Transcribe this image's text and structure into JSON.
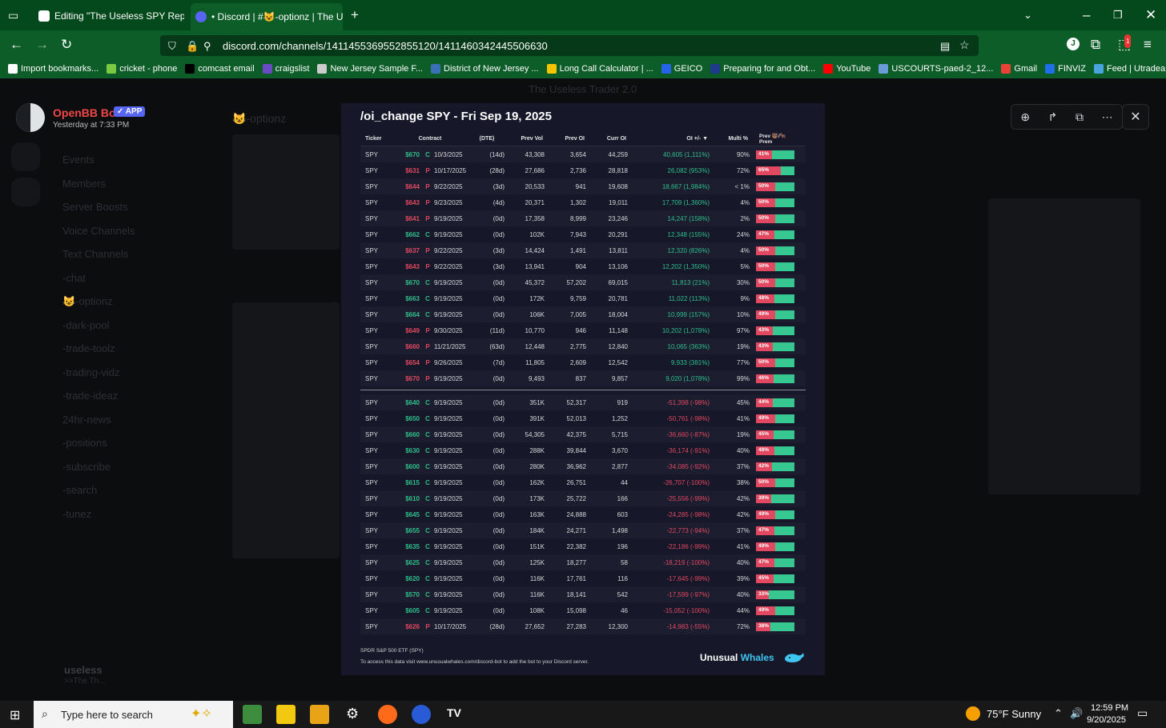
{
  "browser": {
    "tabs": [
      {
        "label": "Editing \"The Useless SPY Report",
        "active": false
      },
      {
        "label": "• Discord | #😺-optionz | The U",
        "active": true
      }
    ],
    "url": "discord.com/channels/1411455369552855120/1411460342445506630",
    "bookmarks": [
      "Import bookmarks...",
      "cricket - phone",
      "comcast email",
      "craigslist",
      "New Jersey Sample F...",
      "District of New Jersey ...",
      "Long Call Calculator | ...",
      "GEICO",
      "Preparing for and Obt...",
      "YouTube",
      "USCOURTS-paed-2_12...",
      "Gmail",
      "FINVIZ",
      "Feed | Utradea"
    ],
    "bookmark_icon_colors": [
      "#ffffff",
      "#7ac943",
      "#000000",
      "#6a4bc4",
      "#cccccc",
      "#3b6fb6",
      "#f5c400",
      "#2563eb",
      "#1e3a8a",
      "#ff0000",
      "#6a9bd8",
      "#ea4335",
      "#1f6feb",
      "#4aa3df"
    ],
    "extension_badge": "1",
    "profile_initial": "J"
  },
  "background": {
    "server_name": "The Useless Trader 2.0",
    "channel": "😺-optionz",
    "sidebar_items": [
      "Events",
      "Members",
      "Server Boosts",
      "Voice Channels",
      "Text Channels",
      "-chat",
      "😺-optionz",
      "-dark-pool",
      "-trade-toolz",
      "-trading-vidz",
      "-trade-ideaz",
      "24hr-news",
      "-positions",
      "-subscribe",
      "-search",
      "-tunez"
    ],
    "user_name": "useless",
    "user_status": ">>The Th..."
  },
  "message": {
    "bot_name": "OpenBB Bot",
    "badge": "✓ APP",
    "time": "Yesterday at 7:33 PM"
  },
  "report": {
    "title": "/oi_change SPY - Fri Sep 19, 2025",
    "headers": [
      "Ticker",
      "Contract",
      "(DTE)",
      "Prev Vol",
      "Prev OI",
      "Curr OI",
      "OI +/- ▼",
      "Multi %",
      "Prev 🐻/🐂 Prem"
    ],
    "gainers": [
      {
        "ticker": "SPY",
        "strike": "$670",
        "type": "C",
        "date": "10/3/2025",
        "dte": "(14d)",
        "prev_vol": "43,308",
        "prev_oi": "3,654",
        "curr_oi": "44,259",
        "oi_change": "40,605 (1,111%)",
        "multi": "90%",
        "prem": "41%",
        "prem_frac": 0.41
      },
      {
        "ticker": "SPY",
        "strike": "$631",
        "type": "P",
        "date": "10/17/2025",
        "dte": "(28d)",
        "prev_vol": "27,686",
        "prev_oi": "2,736",
        "curr_oi": "28,818",
        "oi_change": "26,082 (953%)",
        "multi": "72%",
        "prem": "65%",
        "prem_frac": 0.65
      },
      {
        "ticker": "SPY",
        "strike": "$644",
        "type": "P",
        "date": "9/22/2025",
        "dte": "(3d)",
        "prev_vol": "20,533",
        "prev_oi": "941",
        "curr_oi": "19,608",
        "oi_change": "18,667 (1,984%)",
        "multi": "< 1%",
        "prem": "50%",
        "prem_frac": 0.5
      },
      {
        "ticker": "SPY",
        "strike": "$643",
        "type": "P",
        "date": "9/23/2025",
        "dte": "(4d)",
        "prev_vol": "20,371",
        "prev_oi": "1,302",
        "curr_oi": "19,011",
        "oi_change": "17,709 (1,360%)",
        "multi": "4%",
        "prem": "50%",
        "prem_frac": 0.5
      },
      {
        "ticker": "SPY",
        "strike": "$641",
        "type": "P",
        "date": "9/19/2025",
        "dte": "(0d)",
        "prev_vol": "17,358",
        "prev_oi": "8,999",
        "curr_oi": "23,246",
        "oi_change": "14,247 (158%)",
        "multi": "2%",
        "prem": "50%",
        "prem_frac": 0.5
      },
      {
        "ticker": "SPY",
        "strike": "$662",
        "type": "C",
        "date": "9/19/2025",
        "dte": "(0d)",
        "prev_vol": "102K",
        "prev_oi": "7,943",
        "curr_oi": "20,291",
        "oi_change": "12,348 (155%)",
        "multi": "24%",
        "prem": "47%",
        "prem_frac": 0.47
      },
      {
        "ticker": "SPY",
        "strike": "$637",
        "type": "P",
        "date": "9/22/2025",
        "dte": "(3d)",
        "prev_vol": "14,424",
        "prev_oi": "1,491",
        "curr_oi": "13,811",
        "oi_change": "12,320 (826%)",
        "multi": "4%",
        "prem": "50%",
        "prem_frac": 0.5
      },
      {
        "ticker": "SPY",
        "strike": "$643",
        "type": "P",
        "date": "9/22/2025",
        "dte": "(3d)",
        "prev_vol": "13,941",
        "prev_oi": "904",
        "curr_oi": "13,106",
        "oi_change": "12,202 (1,350%)",
        "multi": "5%",
        "prem": "50%",
        "prem_frac": 0.5
      },
      {
        "ticker": "SPY",
        "strike": "$670",
        "type": "C",
        "date": "9/19/2025",
        "dte": "(0d)",
        "prev_vol": "45,372",
        "prev_oi": "57,202",
        "curr_oi": "69,015",
        "oi_change": "11,813 (21%)",
        "multi": "30%",
        "prem": "50%",
        "prem_frac": 0.5
      },
      {
        "ticker": "SPY",
        "strike": "$663",
        "type": "C",
        "date": "9/19/2025",
        "dte": "(0d)",
        "prev_vol": "172K",
        "prev_oi": "9,759",
        "curr_oi": "20,781",
        "oi_change": "11,022 (113%)",
        "multi": "9%",
        "prem": "48%",
        "prem_frac": 0.48
      },
      {
        "ticker": "SPY",
        "strike": "$664",
        "type": "C",
        "date": "9/19/2025",
        "dte": "(0d)",
        "prev_vol": "106K",
        "prev_oi": "7,005",
        "curr_oi": "18,004",
        "oi_change": "10,999 (157%)",
        "multi": "10%",
        "prem": "49%",
        "prem_frac": 0.49
      },
      {
        "ticker": "SPY",
        "strike": "$649",
        "type": "P",
        "date": "9/30/2025",
        "dte": "(11d)",
        "prev_vol": "10,770",
        "prev_oi": "946",
        "curr_oi": "11,148",
        "oi_change": "10,202 (1,078%)",
        "multi": "97%",
        "prem": "43%",
        "prem_frac": 0.43
      },
      {
        "ticker": "SPY",
        "strike": "$660",
        "type": "P",
        "date": "11/21/2025",
        "dte": "(63d)",
        "prev_vol": "12,448",
        "prev_oi": "2,775",
        "curr_oi": "12,840",
        "oi_change": "10,065 (363%)",
        "multi": "19%",
        "prem": "43%",
        "prem_frac": 0.43
      },
      {
        "ticker": "SPY",
        "strike": "$654",
        "type": "P",
        "date": "9/26/2025",
        "dte": "(7d)",
        "prev_vol": "11,805",
        "prev_oi": "2,609",
        "curr_oi": "12,542",
        "oi_change": "9,933 (381%)",
        "multi": "77%",
        "prem": "50%",
        "prem_frac": 0.5
      },
      {
        "ticker": "SPY",
        "strike": "$670",
        "type": "P",
        "date": "9/19/2025",
        "dte": "(0d)",
        "prev_vol": "9,493",
        "prev_oi": "837",
        "curr_oi": "9,857",
        "oi_change": "9,020 (1,078%)",
        "multi": "99%",
        "prem": "46%",
        "prem_frac": 0.46
      }
    ],
    "losers": [
      {
        "ticker": "SPY",
        "strike": "$640",
        "type": "C",
        "date": "9/19/2025",
        "dte": "(0d)",
        "prev_vol": "351K",
        "prev_oi": "52,317",
        "curr_oi": "919",
        "oi_change": "-51,398 (-98%)",
        "multi": "45%",
        "prem": "44%",
        "prem_frac": 0.44
      },
      {
        "ticker": "SPY",
        "strike": "$650",
        "type": "C",
        "date": "9/19/2025",
        "dte": "(0d)",
        "prev_vol": "391K",
        "prev_oi": "52,013",
        "curr_oi": "1,252",
        "oi_change": "-50,761 (-98%)",
        "multi": "41%",
        "prem": "49%",
        "prem_frac": 0.49
      },
      {
        "ticker": "SPY",
        "strike": "$660",
        "type": "C",
        "date": "9/19/2025",
        "dte": "(0d)",
        "prev_vol": "54,305",
        "prev_oi": "42,375",
        "curr_oi": "5,715",
        "oi_change": "-36,660 (-87%)",
        "multi": "19%",
        "prem": "45%",
        "prem_frac": 0.45
      },
      {
        "ticker": "SPY",
        "strike": "$630",
        "type": "C",
        "date": "9/19/2025",
        "dte": "(0d)",
        "prev_vol": "288K",
        "prev_oi": "39,844",
        "curr_oi": "3,670",
        "oi_change": "-36,174 (-91%)",
        "multi": "40%",
        "prem": "48%",
        "prem_frac": 0.48
      },
      {
        "ticker": "SPY",
        "strike": "$600",
        "type": "C",
        "date": "9/19/2025",
        "dte": "(0d)",
        "prev_vol": "280K",
        "prev_oi": "36,962",
        "curr_oi": "2,877",
        "oi_change": "-34,085 (-92%)",
        "multi": "37%",
        "prem": "42%",
        "prem_frac": 0.42
      },
      {
        "ticker": "SPY",
        "strike": "$615",
        "type": "C",
        "date": "9/19/2025",
        "dte": "(0d)",
        "prev_vol": "162K",
        "prev_oi": "26,751",
        "curr_oi": "44",
        "oi_change": "-26,707 (-100%)",
        "multi": "38%",
        "prem": "50%",
        "prem_frac": 0.5
      },
      {
        "ticker": "SPY",
        "strike": "$610",
        "type": "C",
        "date": "9/19/2025",
        "dte": "(0d)",
        "prev_vol": "173K",
        "prev_oi": "25,722",
        "curr_oi": "166",
        "oi_change": "-25,556 (-99%)",
        "multi": "42%",
        "prem": "39%",
        "prem_frac": 0.39
      },
      {
        "ticker": "SPY",
        "strike": "$645",
        "type": "C",
        "date": "9/19/2025",
        "dte": "(0d)",
        "prev_vol": "163K",
        "prev_oi": "24,888",
        "curr_oi": "603",
        "oi_change": "-24,285 (-98%)",
        "multi": "42%",
        "prem": "49%",
        "prem_frac": 0.49
      },
      {
        "ticker": "SPY",
        "strike": "$655",
        "type": "C",
        "date": "9/19/2025",
        "dte": "(0d)",
        "prev_vol": "184K",
        "prev_oi": "24,271",
        "curr_oi": "1,498",
        "oi_change": "-22,773 (-94%)",
        "multi": "37%",
        "prem": "47%",
        "prem_frac": 0.47
      },
      {
        "ticker": "SPY",
        "strike": "$635",
        "type": "C",
        "date": "9/19/2025",
        "dte": "(0d)",
        "prev_vol": "151K",
        "prev_oi": "22,382",
        "curr_oi": "196",
        "oi_change": "-22,186 (-99%)",
        "multi": "41%",
        "prem": "49%",
        "prem_frac": 0.49
      },
      {
        "ticker": "SPY",
        "strike": "$625",
        "type": "C",
        "date": "9/19/2025",
        "dte": "(0d)",
        "prev_vol": "125K",
        "prev_oi": "18,277",
        "curr_oi": "58",
        "oi_change": "-18,219 (-100%)",
        "multi": "40%",
        "prem": "47%",
        "prem_frac": 0.47
      },
      {
        "ticker": "SPY",
        "strike": "$620",
        "type": "C",
        "date": "9/19/2025",
        "dte": "(0d)",
        "prev_vol": "116K",
        "prev_oi": "17,761",
        "curr_oi": "116",
        "oi_change": "-17,645 (-99%)",
        "multi": "39%",
        "prem": "45%",
        "prem_frac": 0.45
      },
      {
        "ticker": "SPY",
        "strike": "$570",
        "type": "C",
        "date": "9/19/2025",
        "dte": "(0d)",
        "prev_vol": "116K",
        "prev_oi": "18,141",
        "curr_oi": "542",
        "oi_change": "-17,599 (-97%)",
        "multi": "40%",
        "prem": "33%",
        "prem_frac": 0.33
      },
      {
        "ticker": "SPY",
        "strike": "$605",
        "type": "C",
        "date": "9/19/2025",
        "dte": "(0d)",
        "prev_vol": "108K",
        "prev_oi": "15,098",
        "curr_oi": "46",
        "oi_change": "-15,052 (-100%)",
        "multi": "44%",
        "prem": "49%",
        "prem_frac": 0.49
      },
      {
        "ticker": "SPY",
        "strike": "$626",
        "type": "P",
        "date": "10/17/2025",
        "dte": "(28d)",
        "prev_vol": "27,652",
        "prev_oi": "27,283",
        "curr_oi": "12,300",
        "oi_change": "-14,983 (-55%)",
        "multi": "72%",
        "prem": "38%",
        "prem_frac": 0.38
      }
    ],
    "footer_line1": "SPDR S&P 500 ETF (SPY)",
    "footer_line2": "To access this data visit www.unusualwhales.com/discord-bot to add the bot to your Discord server.",
    "brand_a": "Unusual",
    "brand_b": "Whales"
  },
  "taskbar": {
    "search_placeholder": "Type here to search",
    "weather": "75°F  Sunny",
    "time": "12:59 PM",
    "date": "9/20/2025"
  },
  "colors": {
    "chrome_green": "#0d5d28",
    "call": "#2fbf8a",
    "put": "#e24860",
    "report_bg": "#16182a"
  }
}
